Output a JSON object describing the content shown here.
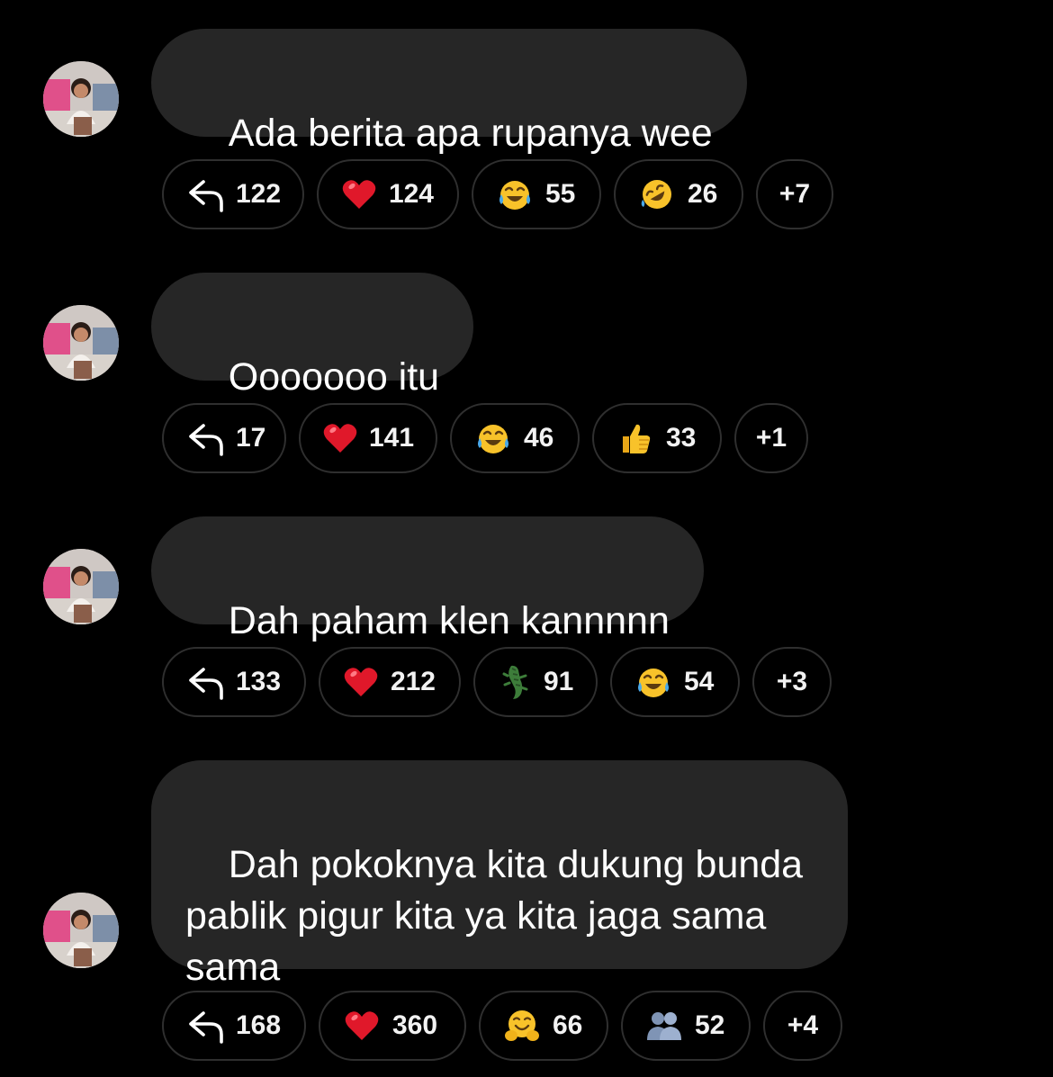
{
  "messages": [
    {
      "text": "Ada berita apa rupanya wee",
      "reactions": [
        {
          "icon": "reply-icon",
          "count": "122"
        },
        {
          "icon": "heart-icon",
          "count": "124"
        },
        {
          "icon": "tears-of-joy-icon",
          "count": "55"
        },
        {
          "icon": "rolling-laughing-icon",
          "count": "26"
        },
        {
          "icon": "more",
          "count": "+7"
        }
      ]
    },
    {
      "text": "Ooooooo itu",
      "reactions": [
        {
          "icon": "reply-icon",
          "count": "17"
        },
        {
          "icon": "heart-icon",
          "count": "141"
        },
        {
          "icon": "tears-of-joy-icon",
          "count": "46"
        },
        {
          "icon": "thumbs-up-icon",
          "count": "33"
        },
        {
          "icon": "more",
          "count": "+1"
        }
      ]
    },
    {
      "text": "Dah paham klen kannnnn",
      "reactions": [
        {
          "icon": "reply-icon",
          "count": "133"
        },
        {
          "icon": "heart-icon",
          "count": "212"
        },
        {
          "icon": "crocodile-icon",
          "count": "91"
        },
        {
          "icon": "tears-of-joy-icon",
          "count": "54"
        },
        {
          "icon": "more",
          "count": "+3"
        }
      ]
    },
    {
      "text": "Dah pokoknya kita dukung bunda\npablik pigur kita ya kita jaga sama\nsama",
      "reactions": [
        {
          "icon": "reply-icon",
          "count": "168"
        },
        {
          "icon": "heart-icon",
          "count": "360"
        },
        {
          "icon": "hugging-face-icon",
          "count": "66"
        },
        {
          "icon": "busts-icon",
          "count": "52"
        },
        {
          "icon": "more",
          "count": "+4"
        }
      ]
    }
  ],
  "colors": {
    "background": "#000000",
    "bubble": "#262626",
    "pill_border": "#2f2f2f",
    "heart": "#e0182a",
    "emoji_yellow": "#f8c22a"
  }
}
